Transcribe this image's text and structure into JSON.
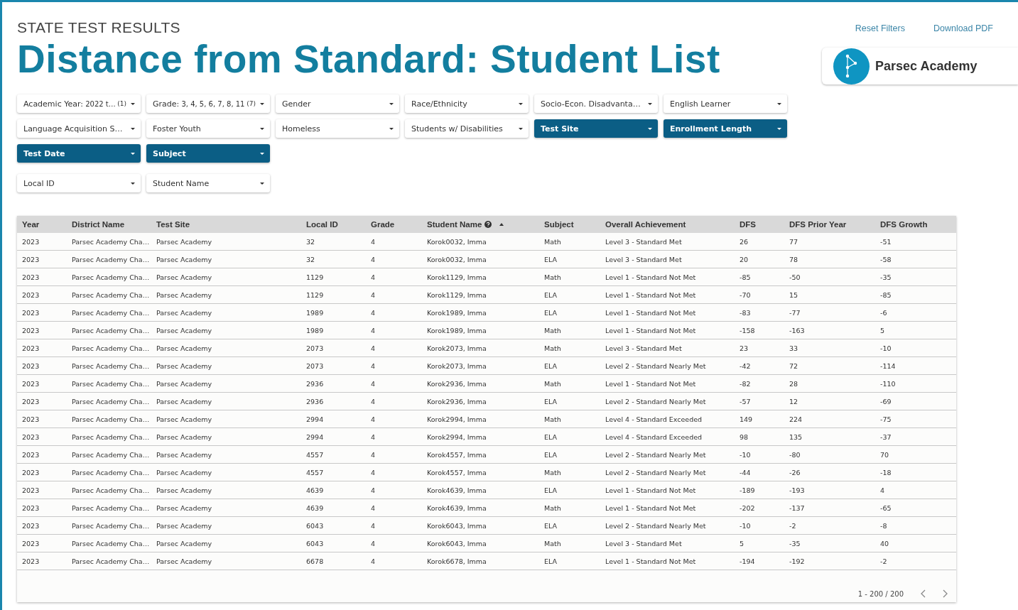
{
  "header": {
    "subtitle": "STATE TEST RESULTS",
    "title": "Distance from Standard: Student List",
    "links": [
      "Reset Filters",
      "Download PDF"
    ],
    "school": "Parsec Academy"
  },
  "filter_groups": [
    [
      {
        "label": "Academic Year:",
        "value": "2022 t…",
        "count": "(1)",
        "active": false
      },
      {
        "label": "Grade:",
        "value": "3, 4, 5, 6, 7, 8, 11",
        "count": "(7)",
        "active": false
      },
      {
        "label": "Gender",
        "active": false
      },
      {
        "label": "Race/Ethnicity",
        "active": false
      },
      {
        "label": "Socio-Econ. Disadvanta…",
        "active": false
      },
      {
        "label": "English Learner",
        "active": false
      },
      {
        "label": "Language Acquisition S…",
        "active": false
      },
      {
        "label": "Foster Youth",
        "active": false
      },
      {
        "label": "Homeless",
        "active": false
      },
      {
        "label": "Students w/ Disabilities",
        "active": false
      },
      {
        "label": "Test Site",
        "active": true
      },
      {
        "label": "Enrollment Length",
        "active": true
      },
      {
        "label": "Test Date",
        "active": true
      },
      {
        "label": "Subject",
        "active": true
      }
    ],
    [
      {
        "label": "Local ID",
        "active": false
      },
      {
        "label": "Student Name",
        "active": false
      }
    ]
  ],
  "table": {
    "columns": [
      {
        "label": "Year",
        "help": false,
        "sorted": false
      },
      {
        "label": "District Name",
        "help": false,
        "sorted": false
      },
      {
        "label": "Test Site",
        "help": false,
        "sorted": false
      },
      {
        "label": "Local ID",
        "help": false,
        "sorted": false
      },
      {
        "label": "Grade",
        "help": false,
        "sorted": false
      },
      {
        "label": "Student Name",
        "help": true,
        "sorted": true
      },
      {
        "label": "Subject",
        "help": false,
        "sorted": false
      },
      {
        "label": "Overall Achievement",
        "help": false,
        "sorted": false
      },
      {
        "label": "DFS",
        "help": false,
        "sorted": false
      },
      {
        "label": "DFS Prior Year",
        "help": false,
        "sorted": false
      },
      {
        "label": "DFS Growth",
        "help": false,
        "sorted": false
      }
    ],
    "rows": [
      [
        "2023",
        "Parsec Academy Cha…",
        "Parsec Academy",
        "32",
        "4",
        "Korok0032, Imma",
        "Math",
        "Level 3 - Standard Met",
        "26",
        "77",
        "-51"
      ],
      [
        "2023",
        "Parsec Academy Cha…",
        "Parsec Academy",
        "32",
        "4",
        "Korok0032, Imma",
        "ELA",
        "Level 3 - Standard Met",
        "20",
        "78",
        "-58"
      ],
      [
        "2023",
        "Parsec Academy Cha…",
        "Parsec Academy",
        "1129",
        "4",
        "Korok1129, Imma",
        "Math",
        "Level 1 - Standard Not Met",
        "-85",
        "-50",
        "-35"
      ],
      [
        "2023",
        "Parsec Academy Cha…",
        "Parsec Academy",
        "1129",
        "4",
        "Korok1129, Imma",
        "ELA",
        "Level 1 - Standard Not Met",
        "-70",
        "15",
        "-85"
      ],
      [
        "2023",
        "Parsec Academy Cha…",
        "Parsec Academy",
        "1989",
        "4",
        "Korok1989, Imma",
        "ELA",
        "Level 1 - Standard Not Met",
        "-83",
        "-77",
        "-6"
      ],
      [
        "2023",
        "Parsec Academy Cha…",
        "Parsec Academy",
        "1989",
        "4",
        "Korok1989, Imma",
        "Math",
        "Level 1 - Standard Not Met",
        "-158",
        "-163",
        "5"
      ],
      [
        "2023",
        "Parsec Academy Cha…",
        "Parsec Academy",
        "2073",
        "4",
        "Korok2073, Imma",
        "Math",
        "Level 3 - Standard Met",
        "23",
        "33",
        "-10"
      ],
      [
        "2023",
        "Parsec Academy Cha…",
        "Parsec Academy",
        "2073",
        "4",
        "Korok2073, Imma",
        "ELA",
        "Level 2 - Standard Nearly Met",
        "-42",
        "72",
        "-114"
      ],
      [
        "2023",
        "Parsec Academy Cha…",
        "Parsec Academy",
        "2936",
        "4",
        "Korok2936, Imma",
        "Math",
        "Level 1 - Standard Not Met",
        "-82",
        "28",
        "-110"
      ],
      [
        "2023",
        "Parsec Academy Cha…",
        "Parsec Academy",
        "2936",
        "4",
        "Korok2936, Imma",
        "ELA",
        "Level 2 - Standard Nearly Met",
        "-57",
        "12",
        "-69"
      ],
      [
        "2023",
        "Parsec Academy Cha…",
        "Parsec Academy",
        "2994",
        "4",
        "Korok2994, Imma",
        "Math",
        "Level 4 - Standard Exceeded",
        "149",
        "224",
        "-75"
      ],
      [
        "2023",
        "Parsec Academy Cha…",
        "Parsec Academy",
        "2994",
        "4",
        "Korok2994, Imma",
        "ELA",
        "Level 4 - Standard Exceeded",
        "98",
        "135",
        "-37"
      ],
      [
        "2023",
        "Parsec Academy Cha…",
        "Parsec Academy",
        "4557",
        "4",
        "Korok4557, Imma",
        "ELA",
        "Level 2 - Standard Nearly Met",
        "-10",
        "-80",
        "70"
      ],
      [
        "2023",
        "Parsec Academy Cha…",
        "Parsec Academy",
        "4557",
        "4",
        "Korok4557, Imma",
        "Math",
        "Level 2 - Standard Nearly Met",
        "-44",
        "-26",
        "-18"
      ],
      [
        "2023",
        "Parsec Academy Cha…",
        "Parsec Academy",
        "4639",
        "4",
        "Korok4639, Imma",
        "ELA",
        "Level 1 - Standard Not Met",
        "-189",
        "-193",
        "4"
      ],
      [
        "2023",
        "Parsec Academy Cha…",
        "Parsec Academy",
        "4639",
        "4",
        "Korok4639, Imma",
        "Math",
        "Level 1 - Standard Not Met",
        "-202",
        "-137",
        "-65"
      ],
      [
        "2023",
        "Parsec Academy Cha…",
        "Parsec Academy",
        "6043",
        "4",
        "Korok6043, Imma",
        "ELA",
        "Level 2 - Standard Nearly Met",
        "-10",
        "-2",
        "-8"
      ],
      [
        "2023",
        "Parsec Academy Cha…",
        "Parsec Academy",
        "6043",
        "4",
        "Korok6043, Imma",
        "Math",
        "Level 3 - Standard Met",
        "5",
        "-35",
        "40"
      ],
      [
        "2023",
        "Parsec Academy Cha…",
        "Parsec Academy",
        "6678",
        "4",
        "Korok6678, Imma",
        "ELA",
        "Level 1 - Standard Not Met",
        "-194",
        "-192",
        "-2"
      ]
    ],
    "pagination": "1 - 200 / 200"
  }
}
